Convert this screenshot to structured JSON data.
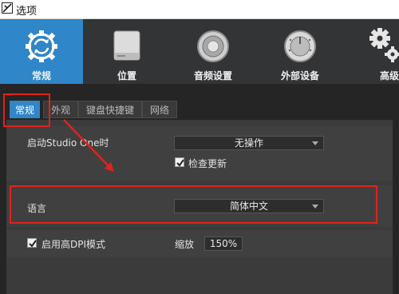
{
  "window": {
    "title": "选项"
  },
  "toolbar": {
    "items": [
      {
        "label": "常规",
        "icon": "refresh-gear-icon",
        "active": true
      },
      {
        "label": "位置",
        "icon": "drive-icon",
        "active": false
      },
      {
        "label": "音频设置",
        "icon": "speaker-icon",
        "active": false
      },
      {
        "label": "外部设备",
        "icon": "knob-icon",
        "active": false
      },
      {
        "label": "高级",
        "icon": "gears-icon",
        "active": false
      }
    ]
  },
  "tabs": [
    {
      "label": "常规",
      "active": true
    },
    {
      "label": "外观",
      "active": false
    },
    {
      "label": "键盘快捷键",
      "active": false
    },
    {
      "label": "网络",
      "active": false
    }
  ],
  "general": {
    "startup_label": "启动Studio One时",
    "startup_value": "无操作",
    "check_updates_label": "检查更新",
    "check_updates_checked": true,
    "language_label": "语言",
    "language_value": "简体中文",
    "high_dpi_label": "启用高DPI模式",
    "high_dpi_checked": true,
    "zoom_label": "缩放",
    "zoom_value": "150%"
  },
  "colors": {
    "accent": "#2f86c8",
    "annotation": "#e0231c"
  }
}
